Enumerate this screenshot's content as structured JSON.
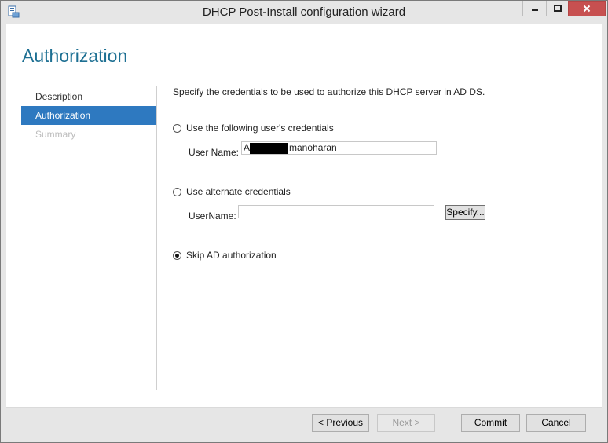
{
  "window": {
    "title": "DHCP Post-Install configuration wizard",
    "controls": {
      "minimize_icon": "minimize-icon",
      "maximize_icon": "maximize-icon",
      "close_icon": "close-icon"
    }
  },
  "page": {
    "heading": "Authorization"
  },
  "nav": {
    "items": [
      {
        "label": "Description",
        "state": "normal"
      },
      {
        "label": "Authorization",
        "state": "active"
      },
      {
        "label": "Summary",
        "state": "disabled"
      }
    ]
  },
  "main": {
    "intro": "Specify the credentials to be used to authorize this DHCP server in AD DS.",
    "options": {
      "current_user": {
        "label": "Use the following user's credentials",
        "selected": false,
        "username_label": "User Name:",
        "username_prefix": "A",
        "username_suffix": "manoharan"
      },
      "alternate": {
        "label": "Use alternate credentials",
        "selected": false,
        "username_label": "UserName:",
        "username_value": "",
        "specify_label": "Specify..."
      },
      "skip": {
        "label": "Skip AD authorization",
        "selected": true
      }
    }
  },
  "footer": {
    "previous_label": "< Previous",
    "next_label": "Next >",
    "commit_label": "Commit",
    "cancel_label": "Cancel"
  },
  "colors": {
    "heading": "#1e7093",
    "nav_active_bg": "#2e79c0",
    "close_button": "#c75050"
  }
}
